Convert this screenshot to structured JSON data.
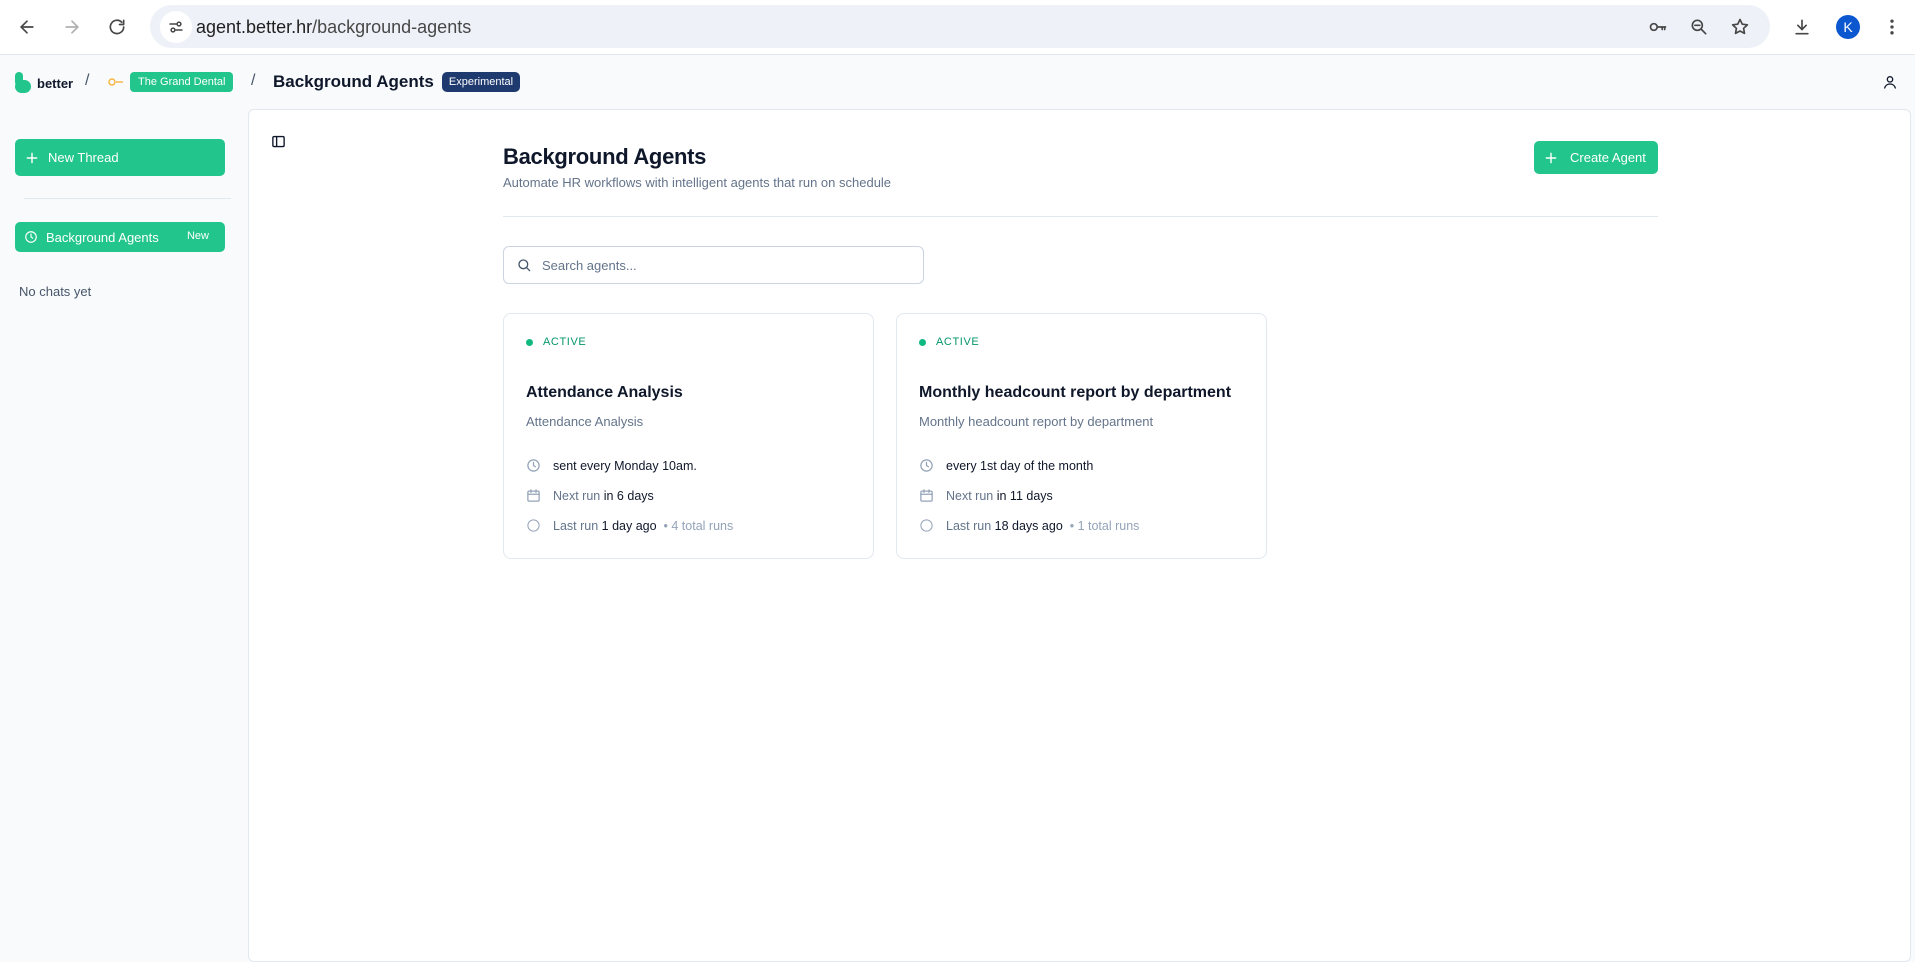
{
  "browser": {
    "url_host": "agent.better.hr",
    "url_path": "/background-agents",
    "profile_initial": "K"
  },
  "header": {
    "logo_text": "better",
    "separator": "/",
    "org_name": "The Grand Dental",
    "page_title": "Background Agents",
    "experimental_label": "Experimental"
  },
  "sidebar": {
    "new_thread_label": "New Thread",
    "items": [
      {
        "label": "Background Agents",
        "tag": "New"
      }
    ],
    "empty_text": "No chats yet"
  },
  "main": {
    "title": "Background Agents",
    "subtitle": "Automate HR workflows with intelligent agents that run on schedule",
    "create_button_label": "Create Agent",
    "search_placeholder": "Search agents...",
    "agents": [
      {
        "status": "ACTIVE",
        "title": "Attendance Analysis",
        "description": "Attendance Analysis",
        "schedule": "sent every Monday 10am.",
        "next_run_label": "Next run",
        "next_run_value": "in 6 days",
        "last_run_label": "Last run",
        "last_run_value": "1 day ago",
        "total_runs": "• 4 total runs"
      },
      {
        "status": "ACTIVE",
        "title": "Monthly headcount report by department",
        "description": "Monthly headcount report by department",
        "schedule": "every 1st day of the month",
        "next_run_label": "Next run",
        "next_run_value": "in 11 days",
        "last_run_label": "Last run",
        "last_run_value": "18 days ago",
        "total_runs": "• 1 total runs"
      }
    ]
  },
  "colors": {
    "accent": "#22c58b",
    "active_status": "#059669",
    "experimental_badge": "#1e3a6f",
    "profile_avatar": "#0b57d0"
  }
}
